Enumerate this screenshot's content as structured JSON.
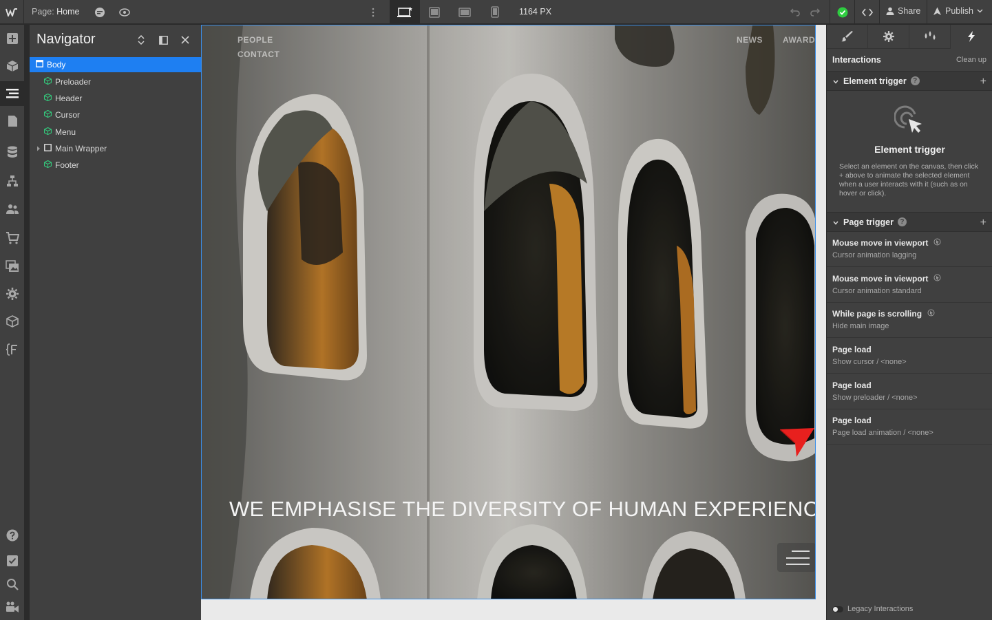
{
  "topbar": {
    "page_prefix": "Page:",
    "page_name": "Home",
    "width_readout": "1164 PX",
    "share_label": "Share",
    "publish_label": "Publish"
  },
  "navigator": {
    "title": "Navigator",
    "items": [
      {
        "label": "Body",
        "icon": "box-icon",
        "selected": true
      },
      {
        "label": "Preloader",
        "icon": "component-icon"
      },
      {
        "label": "Header",
        "icon": "component-icon"
      },
      {
        "label": "Cursor",
        "icon": "component-icon"
      },
      {
        "label": "Menu",
        "icon": "component-icon"
      },
      {
        "label": "Main Wrapper",
        "icon": "box-icon",
        "collapsed": true
      },
      {
        "label": "Footer",
        "icon": "component-icon"
      }
    ]
  },
  "canvas": {
    "nav_left_1": "PEOPLE",
    "nav_left_2": "CONTACT",
    "nav_right_1": "NEWS",
    "nav_right_2": "AWARDS",
    "headline": "WE EMPHASISE THE DIVERSITY OF HUMAN EXPERIENCE"
  },
  "interactions": {
    "title": "Interactions",
    "clean_up": "Clean up",
    "element_trigger_label": "Element trigger",
    "element_trigger_heading": "Element trigger",
    "element_trigger_desc": "Select an element on the canvas, then click + above to animate the selected element when a user interacts with it (such as on hover or click).",
    "page_trigger_label": "Page trigger",
    "triggers": [
      {
        "name": "Mouse move in viewport",
        "sub": "Cursor animation lagging"
      },
      {
        "name": "Mouse move in viewport",
        "sub": "Cursor animation standard"
      },
      {
        "name": "While page is scrolling",
        "sub": "Hide main image"
      },
      {
        "name": "Page load",
        "sub": "Show cursor / <none>"
      },
      {
        "name": "Page load",
        "sub": "Show preloader / <none>"
      },
      {
        "name": "Page load",
        "sub": "Page load animation / <none>"
      }
    ],
    "legacy_label": "Legacy Interactions"
  },
  "colors": {
    "accent": "#1e7ff2",
    "success": "#2ecc40",
    "cursor_red": "#e8201e"
  }
}
